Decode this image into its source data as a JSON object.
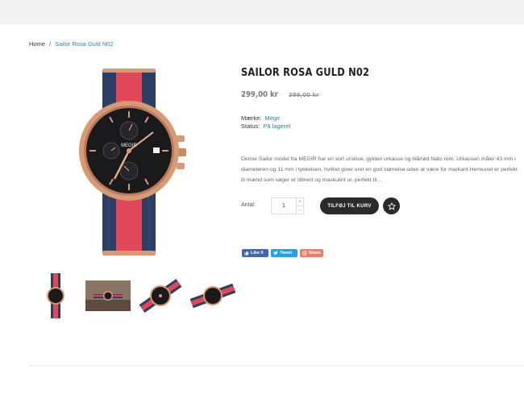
{
  "breadcrumb": {
    "home": "Home",
    "separator": "/",
    "current": "Sailor Rosa Guld N02"
  },
  "product": {
    "title": "SAILOR ROSA GULD N02",
    "price": "299,00 kr",
    "old_price": "399,00 kr",
    "brand_label": "Mærke:",
    "brand_value": "Megir",
    "status_label": "Status:",
    "status_value": "På lageret",
    "description": "Denne Sailor model fra MEGIR har en sort urskive, gylden urkasse og blå/rød Nato rem. Urkassen måler 43 mm i diameteren og 11 mm i tykkelsen, hvilket giver uret en god størrelse uden at være for markant.Herreuret er perfekt til mænd som søger et stilrent og maskulint ur, perfekt til..."
  },
  "cart": {
    "qty_label": "Antal:",
    "qty_value": "1",
    "plus": "+",
    "minus": "–",
    "add_label": "TILFØJ TIL KURV"
  },
  "share": {
    "facebook_label": "Like 0",
    "twitter_label": "Tweet",
    "share_label": "Share"
  },
  "image_watermark": "MEGIR",
  "colors": {
    "accent": "#2a8a9b",
    "button": "#2b2b2b",
    "strap_red": "#e0485a",
    "strap_navy": "#2c3e64",
    "case_gold": "#d79a74"
  },
  "icons": {
    "wishlist": "star-icon",
    "facebook": "thumbs-up-icon",
    "twitter": "twitter-bird-icon",
    "share": "share-icon"
  }
}
